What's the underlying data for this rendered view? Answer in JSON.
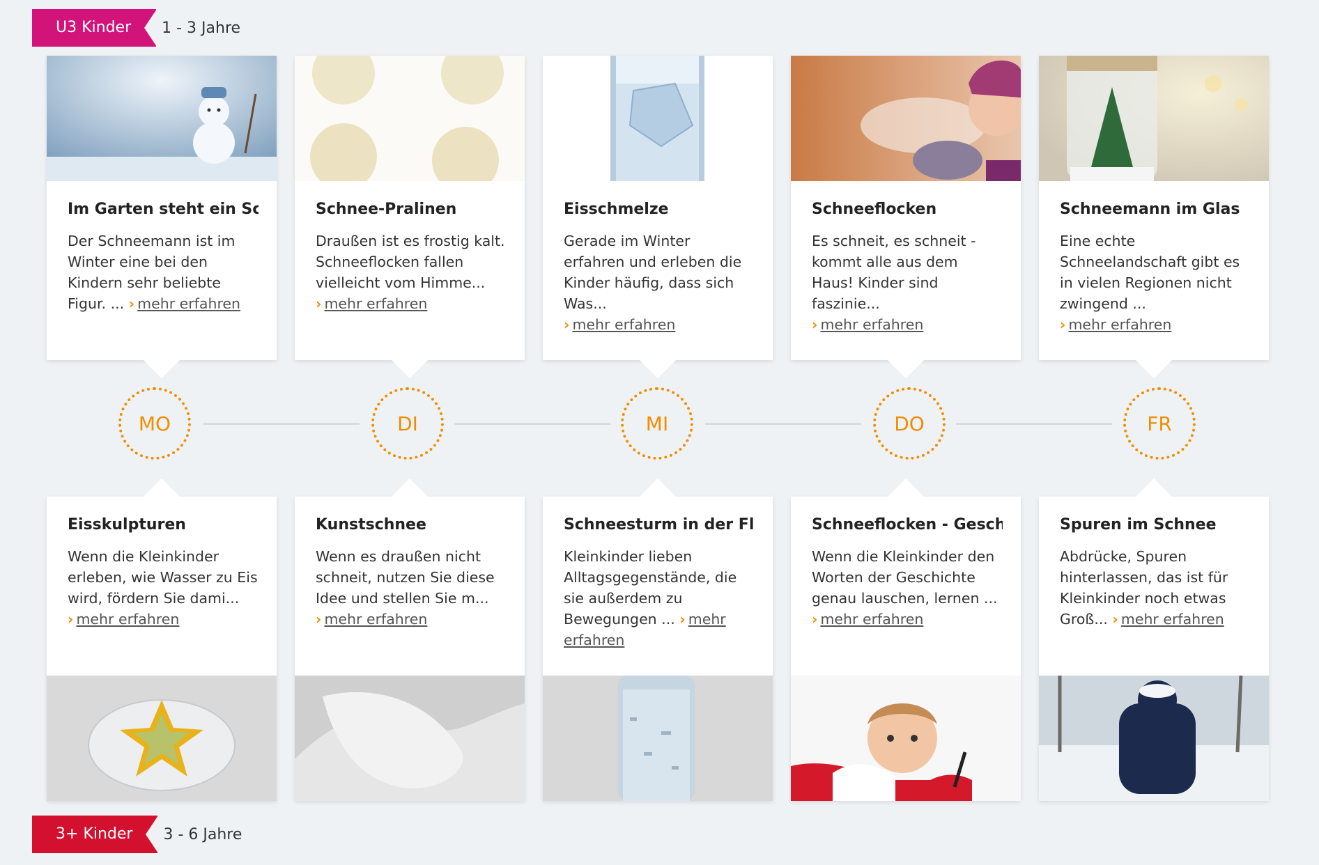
{
  "banners": {
    "u3": {
      "label": "U3 Kinder",
      "range": "1 - 3 Jahre"
    },
    "plus3": {
      "label": "3+ Kinder",
      "range": "3 - 6 Jahre"
    }
  },
  "days": [
    "MO",
    "DI",
    "MI",
    "DO",
    "FR"
  ],
  "more_label": "mehr erfahren",
  "top_cards": [
    {
      "title": "Im Garten steht ein Sc...",
      "text": "Der Schneemann ist im Winter eine bei den Kindern sehr beliebte Figur. ...",
      "image": "snowman-photo"
    },
    {
      "title": "Schnee-Pralinen",
      "text": "Draußen ist es frostig kalt. Schneeflocken fallen vielleicht vom Himme...",
      "image": "coconut-pralines-photo"
    },
    {
      "title": "Eisschmelze",
      "text": "Gerade im Winter erfahren und erleben die Kinder häufig, dass sich Was...",
      "image": "ice-glass-photo"
    },
    {
      "title": "Schneeflocken",
      "text": "Es schneit, es schneit - kommt alle aus dem Haus! Kinder sind faszinie...",
      "image": "child-blowing-snow-photo"
    },
    {
      "title": "Schneemann im Glas",
      "text": "Eine echte Schneelandschaft gibt es in vielen Regionen nicht zwingend ...",
      "image": "snow-globe-tree-photo"
    }
  ],
  "bottom_cards": [
    {
      "title": "Eisskulpturen",
      "text": "Wenn die Kleinkinder erleben, wie Wasser zu Eis wird, fördern Sie dami...",
      "image": "star-ice-mold-photo"
    },
    {
      "title": "Kunstschnee",
      "text": "Wenn es draußen nicht schneit, nutzen Sie diese Idee und stellen Sie m...",
      "image": "artificial-snow-photo"
    },
    {
      "title": "Schneesturm in der Fla...",
      "text": "Kleinkinder lieben Alltagsgegenstände, die sie außerdem zu Bewegungen ...",
      "image": "snow-bottle-photo"
    },
    {
      "title": "Schneeflocken - Gesch...",
      "text": "Wenn die Kleinkinder den Worten der Geschichte genau lauschen, lernen ...",
      "image": "baby-in-snow-photo"
    },
    {
      "title": "Spuren im Schnee",
      "text": "Abdrücke, Spuren hinterlassen, das ist für Kleinkinder noch etwas Groß...",
      "image": "child-snow-forest-photo"
    }
  ]
}
